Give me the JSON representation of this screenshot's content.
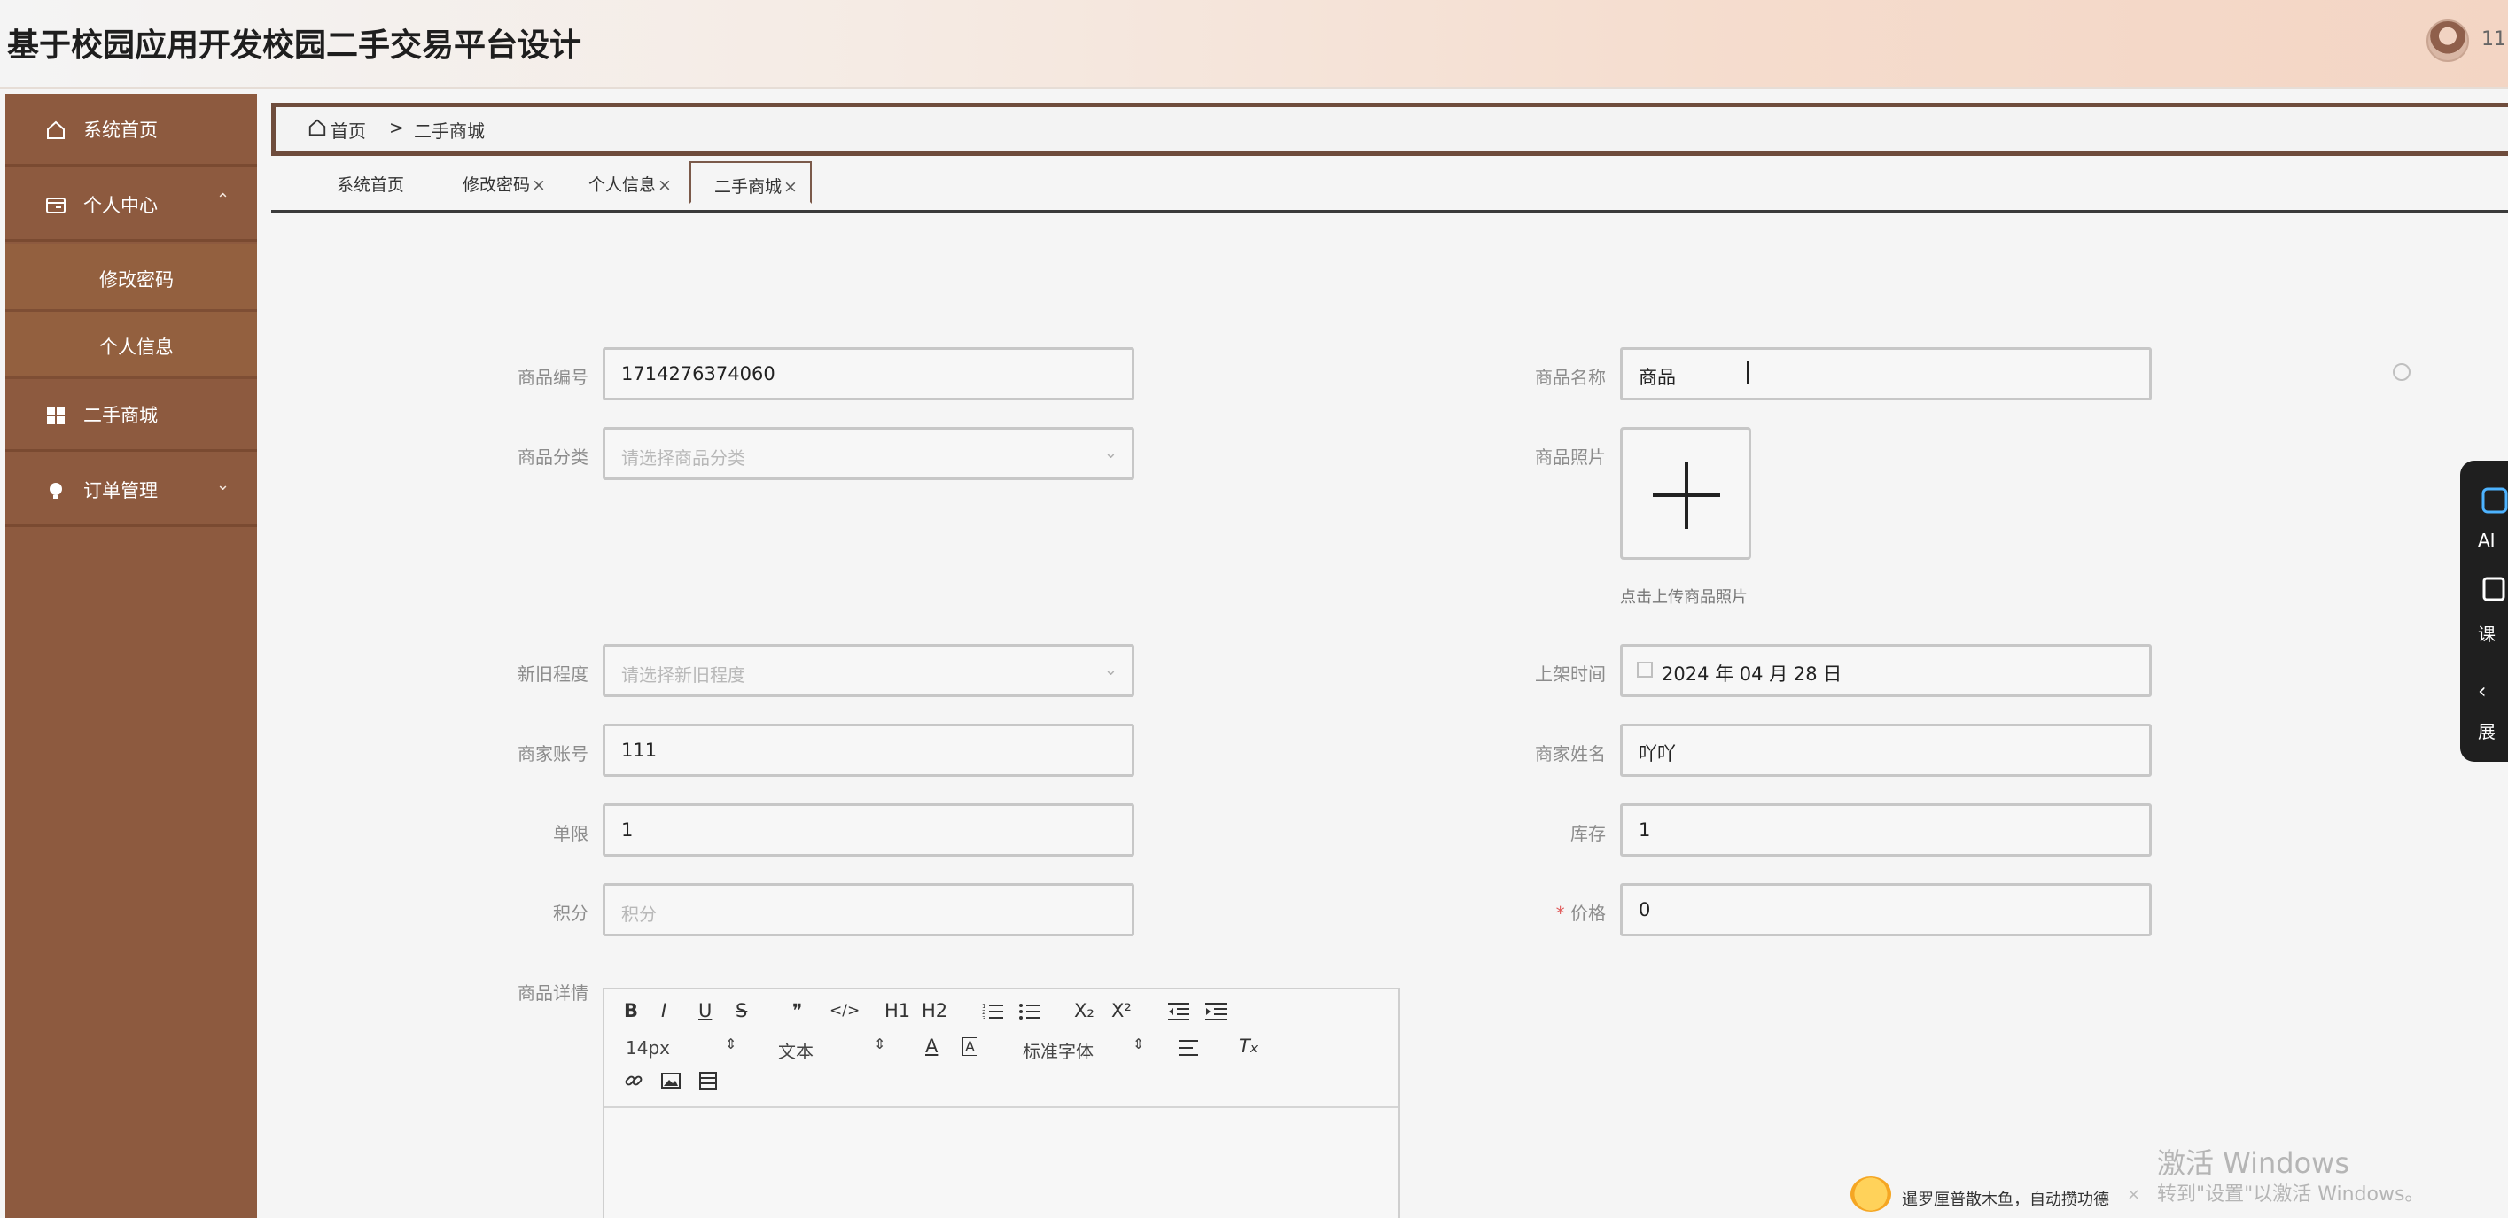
{
  "header": {
    "title": "基于校园应用开发校园二手交易平台设计",
    "username": "11"
  },
  "sidebar": {
    "items": [
      {
        "label": "系统首页",
        "icon": "home-icon"
      },
      {
        "label": "个人中心",
        "icon": "user-card-icon",
        "expanded": true,
        "children": [
          {
            "label": "修改密码"
          },
          {
            "label": "个人信息"
          }
        ]
      },
      {
        "label": "二手商城",
        "icon": "grid-icon"
      },
      {
        "label": "订单管理",
        "icon": "bulb-icon"
      }
    ]
  },
  "breadcrumb": {
    "home": "首页",
    "separator": ">",
    "current": "二手商城"
  },
  "tabs": [
    {
      "label": "系统首页",
      "closable": false
    },
    {
      "label": "修改密码",
      "closable": true
    },
    {
      "label": "个人信息",
      "closable": true
    },
    {
      "label": "二手商城",
      "closable": true,
      "active": true
    }
  ],
  "tab_close_glyph": "×",
  "form": {
    "product_no": {
      "label": "商品编号",
      "value": "1714276374060"
    },
    "product_name": {
      "label": "商品名称",
      "value": "商品"
    },
    "category": {
      "label": "商品分类",
      "placeholder": "请选择商品分类"
    },
    "photo": {
      "label": "商品照片",
      "hint": "点击上传商品照片"
    },
    "condition": {
      "label": "新旧程度",
      "placeholder": "请选择新旧程度"
    },
    "listed_time": {
      "label": "上架时间",
      "value": "2024 年 04 月 28 日"
    },
    "merchant_account": {
      "label": "商家账号",
      "value": "111"
    },
    "merchant_name": {
      "label": "商家姓名",
      "value": "吖吖"
    },
    "limit": {
      "label": "单限",
      "value": "1"
    },
    "stock": {
      "label": "库存",
      "value": "1"
    },
    "points": {
      "label": "积分",
      "placeholder": "积分"
    },
    "price": {
      "label": "价格",
      "required_mark": "*",
      "value": "0"
    },
    "details": {
      "label": "商品详情"
    }
  },
  "editor": {
    "row1": [
      "B",
      "I",
      "U",
      "S",
      "❞",
      "</>",
      "H1",
      "H2",
      "ordered-list",
      "bullet-list",
      "X₂",
      "X²",
      "outdent",
      "indent"
    ],
    "font_size": "14px",
    "block_type": "文本",
    "font_family": "标准字体"
  },
  "side_panel": {
    "items": [
      "AI",
      "课",
      "展"
    ]
  },
  "widget": {
    "text": "暹罗厘普散木鱼，自动攒功德"
  },
  "watermark": {
    "title": "激活 Windows",
    "subtitle": "转到\"设置\"以激活 Windows。"
  }
}
